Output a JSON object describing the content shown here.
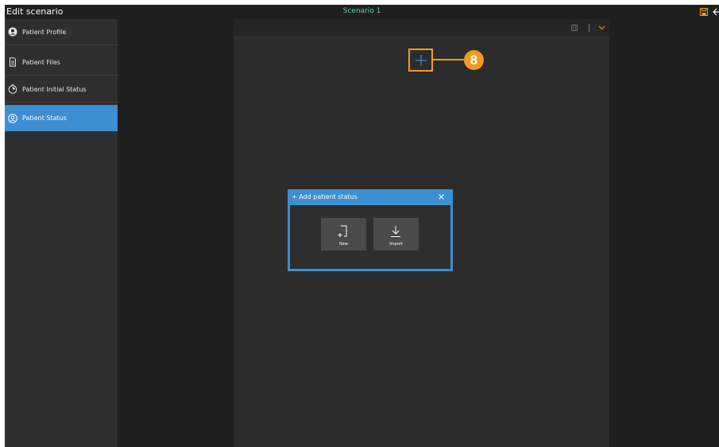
{
  "window": {
    "title": "Edit scenario",
    "scenario_name": "Scenario 1"
  },
  "sidebar": {
    "items": [
      {
        "label": "Patient Profile",
        "icon": "person-circle-icon"
      },
      {
        "label": "Patient Files",
        "icon": "document-icon"
      },
      {
        "label": "Patient Initial Status",
        "icon": "timer-icon"
      },
      {
        "label": "Patient Status",
        "icon": "person-outline-icon",
        "active": true
      }
    ]
  },
  "callout": {
    "number": "8"
  },
  "dialog": {
    "title": "+ Add patient status",
    "buttons": [
      {
        "label": "New",
        "icon": "new-document-icon"
      },
      {
        "label": "Import",
        "icon": "import-arrow-icon"
      }
    ]
  },
  "colors": {
    "accent_blue": "#3d8fd1",
    "highlight_orange": "#f29a20",
    "scenario_green": "#5fd0a0"
  }
}
